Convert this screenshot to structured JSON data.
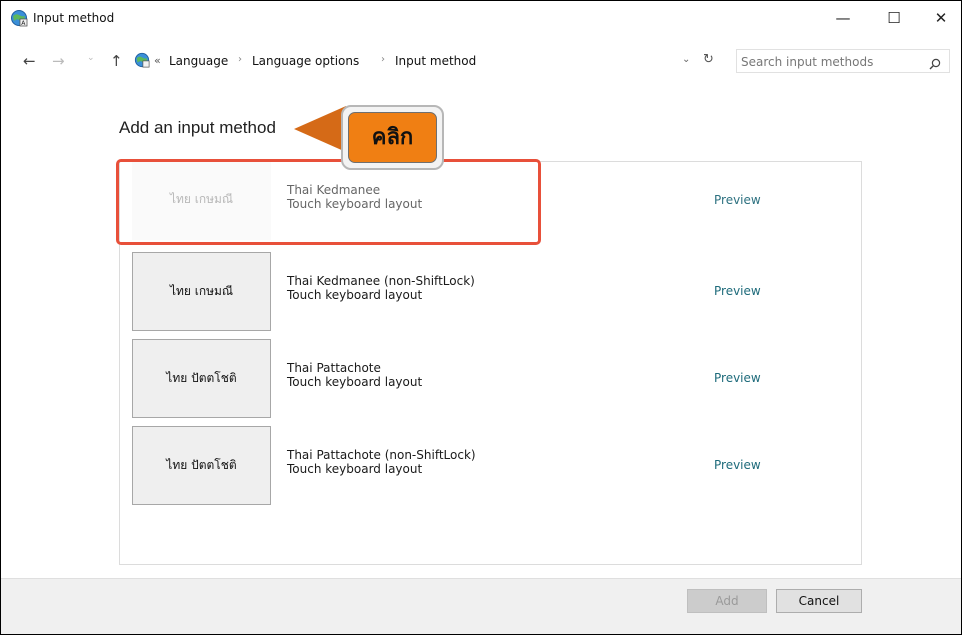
{
  "window": {
    "title": "Input method",
    "icon": "language-globe-icon"
  },
  "controls": {
    "minimize": "—",
    "maximize": "☐",
    "close": "✕"
  },
  "nav": {
    "back": "←",
    "forward": "→",
    "history": "⌄",
    "up": "↑"
  },
  "breadcrumb": {
    "overflow": "«",
    "separator": "›",
    "items": [
      "Language",
      "Language options",
      "Input method"
    ],
    "dropdown": "⌄",
    "refresh": "↻"
  },
  "search": {
    "placeholder": "Search input methods",
    "icon": "search-icon"
  },
  "main": {
    "heading": "Add an input method",
    "items": [
      {
        "thumb": "ไทย เกษมณี",
        "name": "Thai Kedmanee",
        "sub": "Touch keyboard layout",
        "preview": "Preview",
        "selected": true
      },
      {
        "thumb": "ไทย เกษมณี",
        "name": "Thai Kedmanee (non-ShiftLock)",
        "sub": "Touch keyboard layout",
        "preview": "Preview"
      },
      {
        "thumb": "ไทย ปัตตโชติ",
        "name": "Thai Pattachote",
        "sub": "Touch keyboard layout",
        "preview": "Preview"
      },
      {
        "thumb": "ไทย ปัตตโชติ",
        "name": "Thai Pattachote (non-ShiftLock)",
        "sub": "Touch keyboard layout",
        "preview": "Preview"
      }
    ]
  },
  "annotation": {
    "callout": "คลิก",
    "highlight_color": "#e8503a",
    "callout_color": "#f07f13",
    "arrow_color": "#d56a17"
  },
  "footer": {
    "add_label": "Add",
    "add_enabled": false,
    "cancel_label": "Cancel"
  }
}
